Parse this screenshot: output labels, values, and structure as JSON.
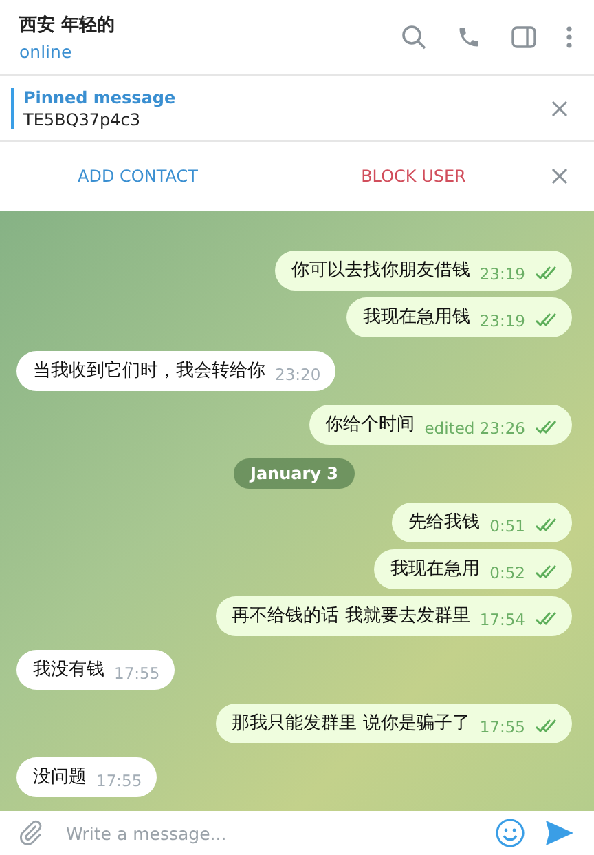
{
  "header": {
    "title": "西安 年轻的",
    "status": "online"
  },
  "pinned": {
    "label": "Pinned message",
    "text": "TE5BQ37p4c3"
  },
  "actions": {
    "add": "ADD CONTACT",
    "block": "BLOCK USER"
  },
  "messages": [
    {
      "kind": "out",
      "text": "你可以去找你朋友借钱",
      "time": "23:19",
      "read": true
    },
    {
      "kind": "out",
      "text": "我现在急用钱",
      "time": "23:19",
      "read": true
    },
    {
      "kind": "in",
      "text": "当我收到它们时，我会转给你",
      "time": "23:20"
    },
    {
      "kind": "out",
      "text": "你给个时间",
      "time": "edited 23:26",
      "read": true
    },
    {
      "kind": "date",
      "text": "January 3"
    },
    {
      "kind": "out",
      "text": "先给我钱",
      "time": "0:51",
      "read": true
    },
    {
      "kind": "out",
      "text": "我现在急用",
      "time": "0:52",
      "read": true
    },
    {
      "kind": "out",
      "text": "再不给钱的话 我就要去发群里",
      "time": "17:54",
      "read": true
    },
    {
      "kind": "in",
      "text": "我没有钱",
      "time": "17:55"
    },
    {
      "kind": "out",
      "text": "那我只能发群里 说你是骗子了",
      "time": "17:55",
      "read": true
    },
    {
      "kind": "in",
      "text": "没问题",
      "time": "17:55"
    }
  ],
  "composer": {
    "placeholder": "Write a message..."
  }
}
